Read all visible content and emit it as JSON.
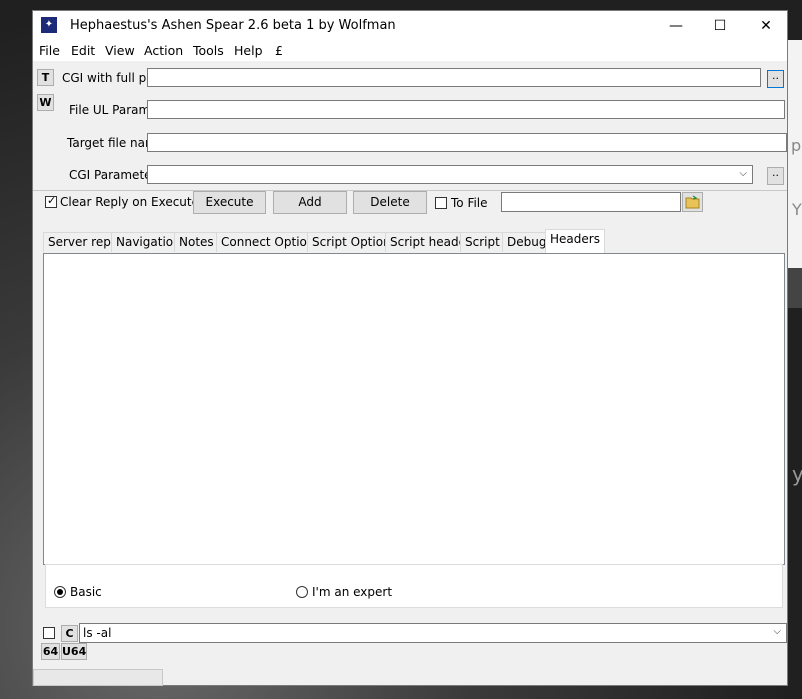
{
  "background": {
    "right_fragment_1": "pl",
    "right_fragment_2": "Y",
    "right_fragment_3": "y"
  },
  "window": {
    "title": "Hephaestus's Ashen Spear 2.6 beta 1 by Wolfman",
    "controls": {
      "minimize": "—",
      "maximize": "☐",
      "close": "✕"
    }
  },
  "menu": [
    "File",
    "Edit",
    "View",
    "Action",
    "Tools",
    "Help",
    "£"
  ],
  "side_buttons": {
    "t": "T",
    "w": "W"
  },
  "fields": {
    "cgi_label": "CGI with full path",
    "cgi_value": "",
    "cgi_browse": "..",
    "file_ul_label": "File UL Param's",
    "file_ul_value": "",
    "target_label": "Target file name",
    "target_value": "",
    "cgi_params_label": "CGI Parameters",
    "cgi_params_value": "",
    "cgi_params_btn": ".."
  },
  "actions": {
    "clear_reply_label": "Clear Reply on Execute",
    "clear_reply_checked": true,
    "execute": "Execute",
    "add": "Add",
    "delete": "Delete",
    "to_file_label": "To File",
    "to_file_checked": false,
    "to_file_path": ""
  },
  "tabs": [
    "Server reply",
    "Navigation",
    "Notes",
    "Connect Options",
    "Script Options",
    "Script header",
    "Script",
    "Debug",
    "Headers"
  ],
  "active_tab": "Headers",
  "radios": {
    "basic": "Basic",
    "expert": "I'm an expert",
    "selected": "Basic"
  },
  "bottom": {
    "c_label": "C",
    "command_value": "ls -al",
    "b64": "64",
    "u64": "U64"
  },
  "icons": {
    "app": "app-icon",
    "folder": "folder-icon",
    "dropdown": "chevron-down-icon"
  }
}
